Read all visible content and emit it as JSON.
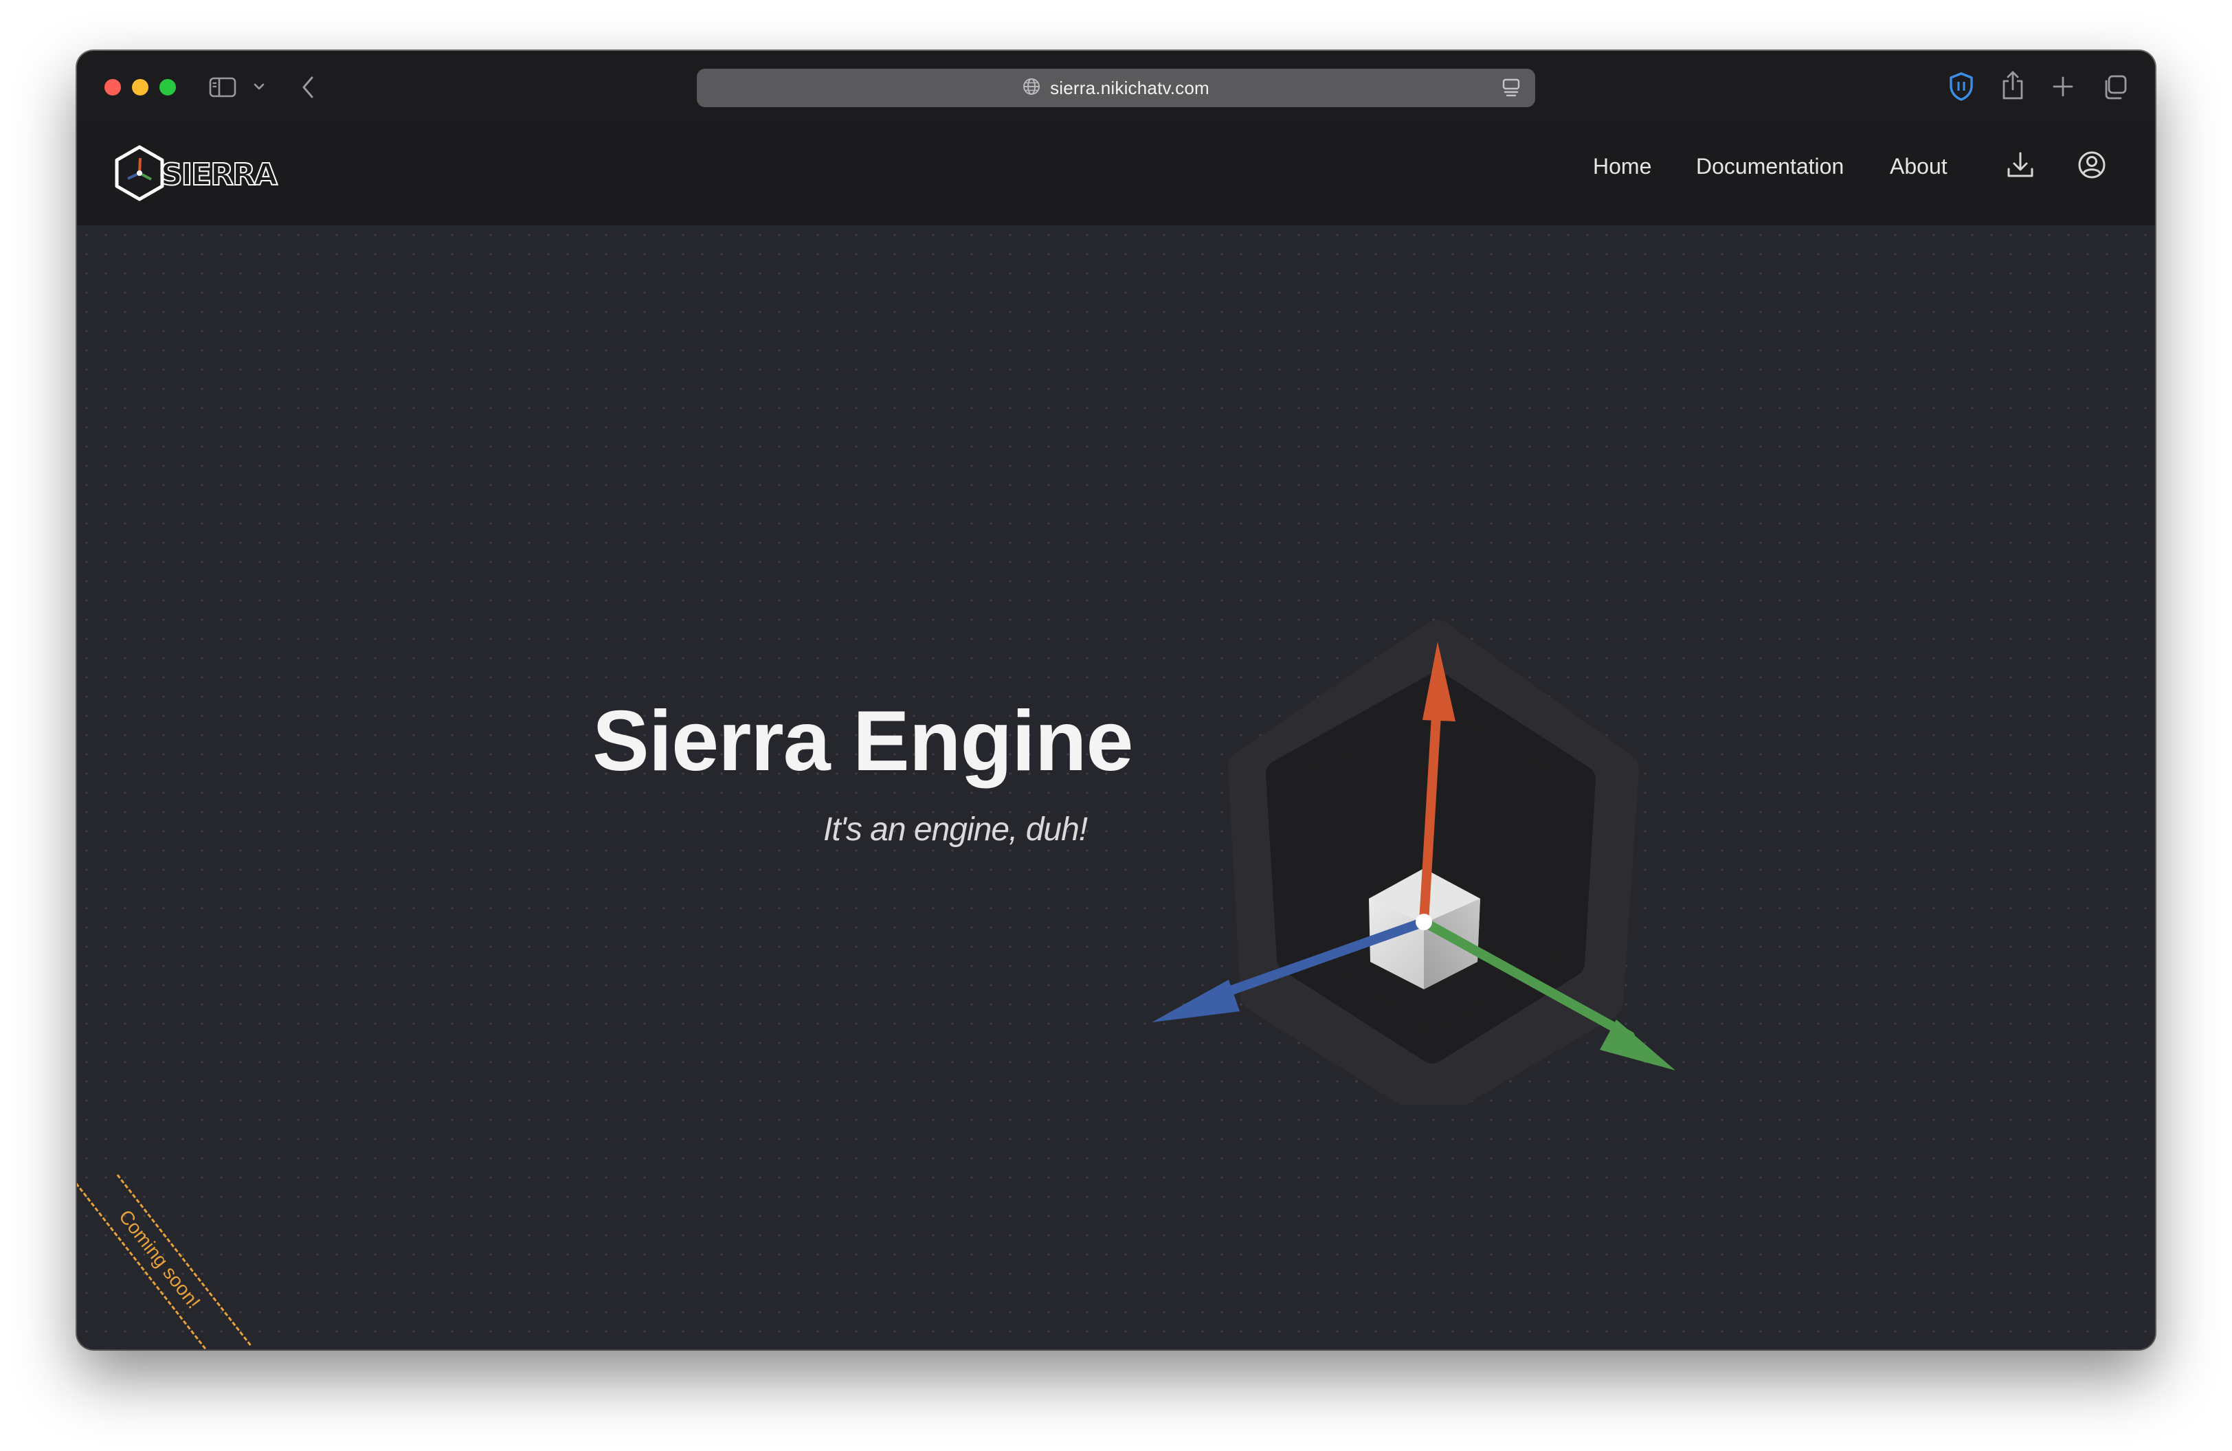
{
  "browser": {
    "url": "sierra.nikichatv.com",
    "icons": [
      "sidebar-icon",
      "chevron-down-icon",
      "back-icon",
      "globe-icon",
      "reader-icon",
      "shield-extension-icon",
      "share-icon",
      "new-tab-icon",
      "tabs-overview-icon"
    ]
  },
  "header": {
    "logo_text": "SIERRA",
    "nav": {
      "home": "Home",
      "documentation": "Documentation",
      "about": "About"
    },
    "icons": [
      "download-icon",
      "account-icon"
    ]
  },
  "hero": {
    "title": "Sierra Engine",
    "subtitle": "It's an engine, duh!",
    "gizmo_colors": {
      "up_axis": "#d2572f",
      "left_axis": "#3d5fa8",
      "right_axis": "#4f9a4c",
      "cube": "#d9d9d9"
    }
  },
  "ribbon": {
    "text": "Coming soon!",
    "color": "#e8a13a"
  }
}
